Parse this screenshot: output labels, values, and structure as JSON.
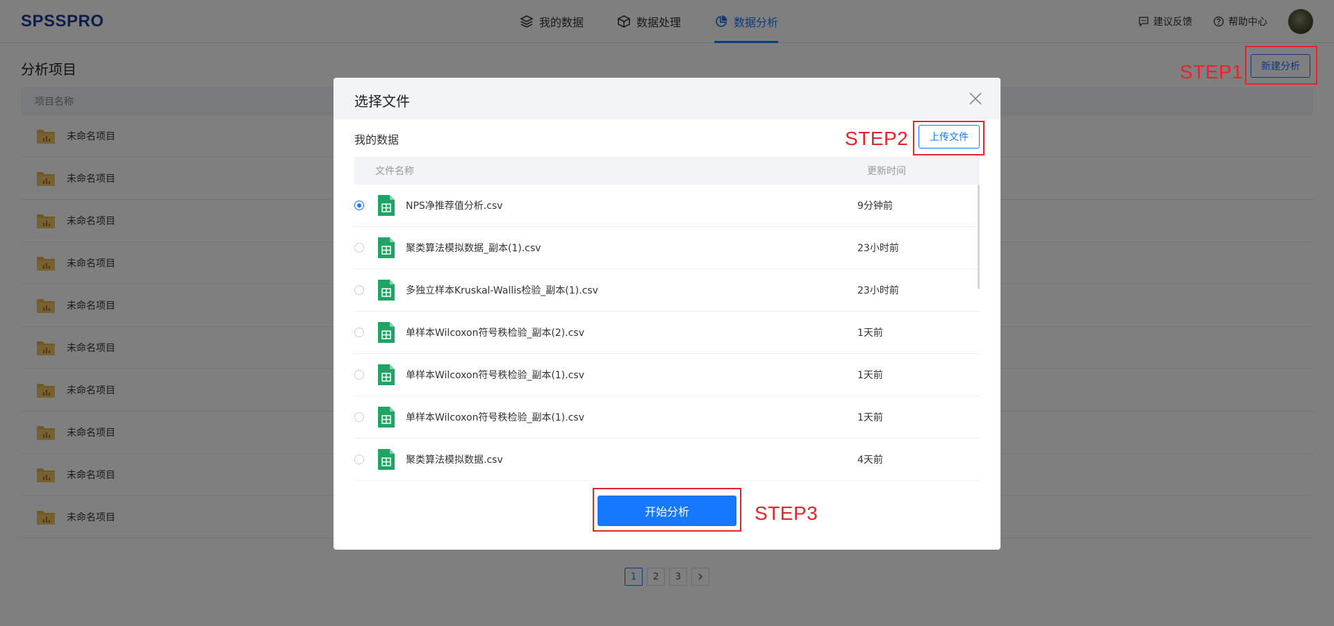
{
  "header": {
    "logo": "SPSSPRO",
    "nav": [
      {
        "label": "我的数据",
        "icon": "layers-icon"
      },
      {
        "label": "数据处理",
        "icon": "cube-icon"
      },
      {
        "label": "数据分析",
        "icon": "pie-chart-icon",
        "active": true
      }
    ],
    "feedback": "建议反馈",
    "help": "帮助中心"
  },
  "page": {
    "title": "分析项目",
    "new_button": "新建分析",
    "column_name": "项目名称",
    "projects": [
      "未命名项目",
      "未命名项目",
      "未命名项目",
      "未命名项目",
      "未命名项目",
      "未命名项目",
      "未命名项目",
      "未命名项目",
      "未命名项目",
      "未命名项目"
    ]
  },
  "pagination": {
    "pages": [
      "1",
      "2",
      "3"
    ],
    "current": "1",
    "next": "›"
  },
  "modal": {
    "title": "选择文件",
    "section": "我的数据",
    "upload_button": "上传文件",
    "col_name": "文件名称",
    "col_time": "更新时间",
    "files": [
      {
        "name": "NPS净推荐值分析.csv",
        "time": "9分钟前",
        "selected": true
      },
      {
        "name": "聚类算法模拟数据_副本(1).csv",
        "time": "23小时前",
        "selected": false
      },
      {
        "name": "多独立样本Kruskal-Wallis检验_副本(1).csv",
        "time": "23小时前",
        "selected": false
      },
      {
        "name": "单样本Wilcoxon符号秩检验_副本(2).csv",
        "time": "1天前",
        "selected": false
      },
      {
        "name": "单样本Wilcoxon符号秩检验_副本(1).csv",
        "time": "1天前",
        "selected": false
      },
      {
        "name": "单样本Wilcoxon符号秩检验_副本(1).csv",
        "time": "1天前",
        "selected": false
      },
      {
        "name": "聚类算法模拟数据.csv",
        "time": "4天前",
        "selected": false
      }
    ],
    "start_button": "开始分析"
  },
  "annotations": {
    "step1": "STEP1",
    "step2": "STEP2",
    "step3": "STEP3"
  },
  "colors": {
    "accent": "#1677ff",
    "annotation": "#e8232a",
    "file_icon": "#21a366",
    "folder": "#e3b24a"
  }
}
